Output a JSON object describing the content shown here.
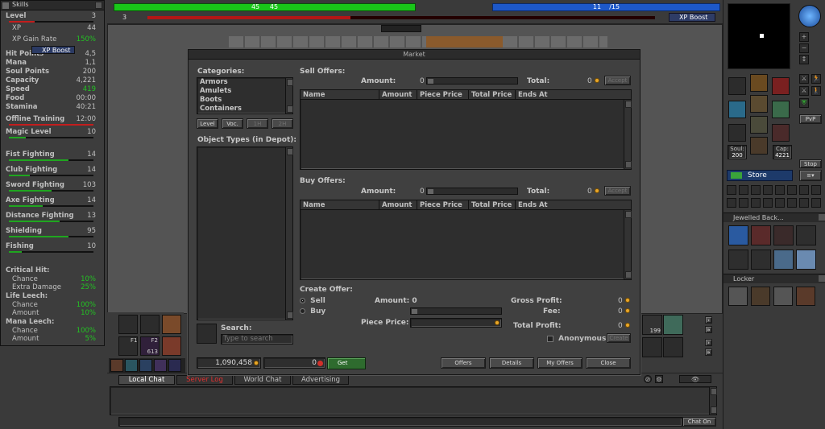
{
  "skills": {
    "title": "Skills",
    "rows": [
      {
        "name": "Level",
        "value": "3"
      },
      {
        "name": "XP",
        "value": "44"
      },
      {
        "name": "XP Gain Rate",
        "value": "150%"
      },
      {
        "name": "Hit Points",
        "value": "4,5"
      },
      {
        "name": "Mana",
        "value": "1,1"
      },
      {
        "name": "Soul Points",
        "value": "200"
      },
      {
        "name": "Capacity",
        "value": "4,221"
      },
      {
        "name": "Speed",
        "value": "419"
      },
      {
        "name": "Food",
        "value": "00:00"
      },
      {
        "name": "Stamina",
        "value": "40:21"
      },
      {
        "name": "Offline Training",
        "value": "12:00"
      },
      {
        "name": "Magic Level",
        "value": "10"
      },
      {
        "name": "Fist Fighting",
        "value": "14"
      },
      {
        "name": "Club Fighting",
        "value": "14"
      },
      {
        "name": "Sword Fighting",
        "value": "103"
      },
      {
        "name": "Axe Fighting",
        "value": "14"
      },
      {
        "name": "Distance Fighting",
        "value": "13"
      },
      {
        "name": "Shielding",
        "value": "95"
      },
      {
        "name": "Fishing",
        "value": "10"
      }
    ],
    "xp_boost_label": "XP Boost",
    "critical_hit": {
      "title": "Critical Hit:",
      "chance_label": "Chance",
      "chance": "10%",
      "extra_label": "Extra Damage",
      "extra": "25%"
    },
    "life_leech": {
      "title": "Life Leech:",
      "chance_label": "Chance",
      "chance": "100%",
      "amount_label": "Amount",
      "amount": "10%"
    },
    "mana_leech": {
      "title": "Mana Leech:",
      "chance_label": "Chance",
      "chance": "100%",
      "amount_label": "Amount",
      "amount": "5%"
    }
  },
  "top": {
    "hp_text": "45     45",
    "mana_text": "11    /15",
    "level_text": "3",
    "xp_boost_label": "XP Boost"
  },
  "market": {
    "title": "Market",
    "categories_label": "Categories:",
    "categories": [
      "Armors",
      "Amulets",
      "Boots",
      "Containers"
    ],
    "filter_buttons": [
      "Level",
      "Voc.",
      "1H",
      "2H"
    ],
    "object_types_label": "Object Types (in Depot):",
    "search_label": "Search:",
    "search_placeholder": "Type to search",
    "sell_offers_label": "Sell Offers:",
    "buy_offers_label": "Buy Offers:",
    "amount_label": "Amount:",
    "amount_value": "0",
    "total_label": "Total:",
    "total_value": "0",
    "accept_label": "Accept",
    "columns": [
      "Name",
      "Amount",
      "Piece Price",
      "Total Price",
      "Ends At"
    ],
    "create_offer_label": "Create Offer:",
    "sell_label": "Sell",
    "buy_label": "Buy",
    "create_amount_label": "Amount: 0",
    "piece_price_label": "Piece Price:",
    "gross_profit_label": "Gross Profit:",
    "gross_profit_value": "0",
    "fee_label": "Fee:",
    "fee_value": "0",
    "total_profit_label": "Total Profit:",
    "total_profit_value": "0",
    "anonymous_label": "Anonymous",
    "create_label": "Create",
    "balance": "1,090,458",
    "coins": "0",
    "get_label": "Get",
    "bottom_buttons": [
      "Offers",
      "Details",
      "My Offers",
      "Close"
    ]
  },
  "chat": {
    "tabs": [
      "Local Chat",
      "Server Log",
      "World Chat",
      "Advertising"
    ],
    "chat_on_label": "Chat On"
  },
  "right": {
    "soul_label": "Soul:",
    "soul_value": "200",
    "cap_label": "Cap:",
    "cap_value": "4221",
    "pvp_label": "PvP",
    "stop_label": "Stop",
    "store_label": "Store",
    "backpack_title": "Jewelled Back...",
    "locker_title": "Locker"
  },
  "hotbar": {
    "f1_label": "F1",
    "f2_label": "F2",
    "count_613": "613",
    "count_199": "199"
  }
}
